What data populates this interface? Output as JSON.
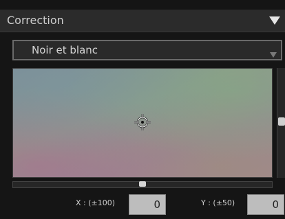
{
  "panel": {
    "title": "Correction",
    "collapse_icon": "triangle-down-icon"
  },
  "mode_select": {
    "value": "Noir et blanc",
    "arrow_icon": "triangle-down-icon"
  },
  "color_pad": {
    "handle_icon": "crosshair-target-icon"
  },
  "fields": {
    "x": {
      "label": "X : (±100)",
      "value": "0"
    },
    "y": {
      "label": "Y : (±50)",
      "value": "0"
    }
  }
}
